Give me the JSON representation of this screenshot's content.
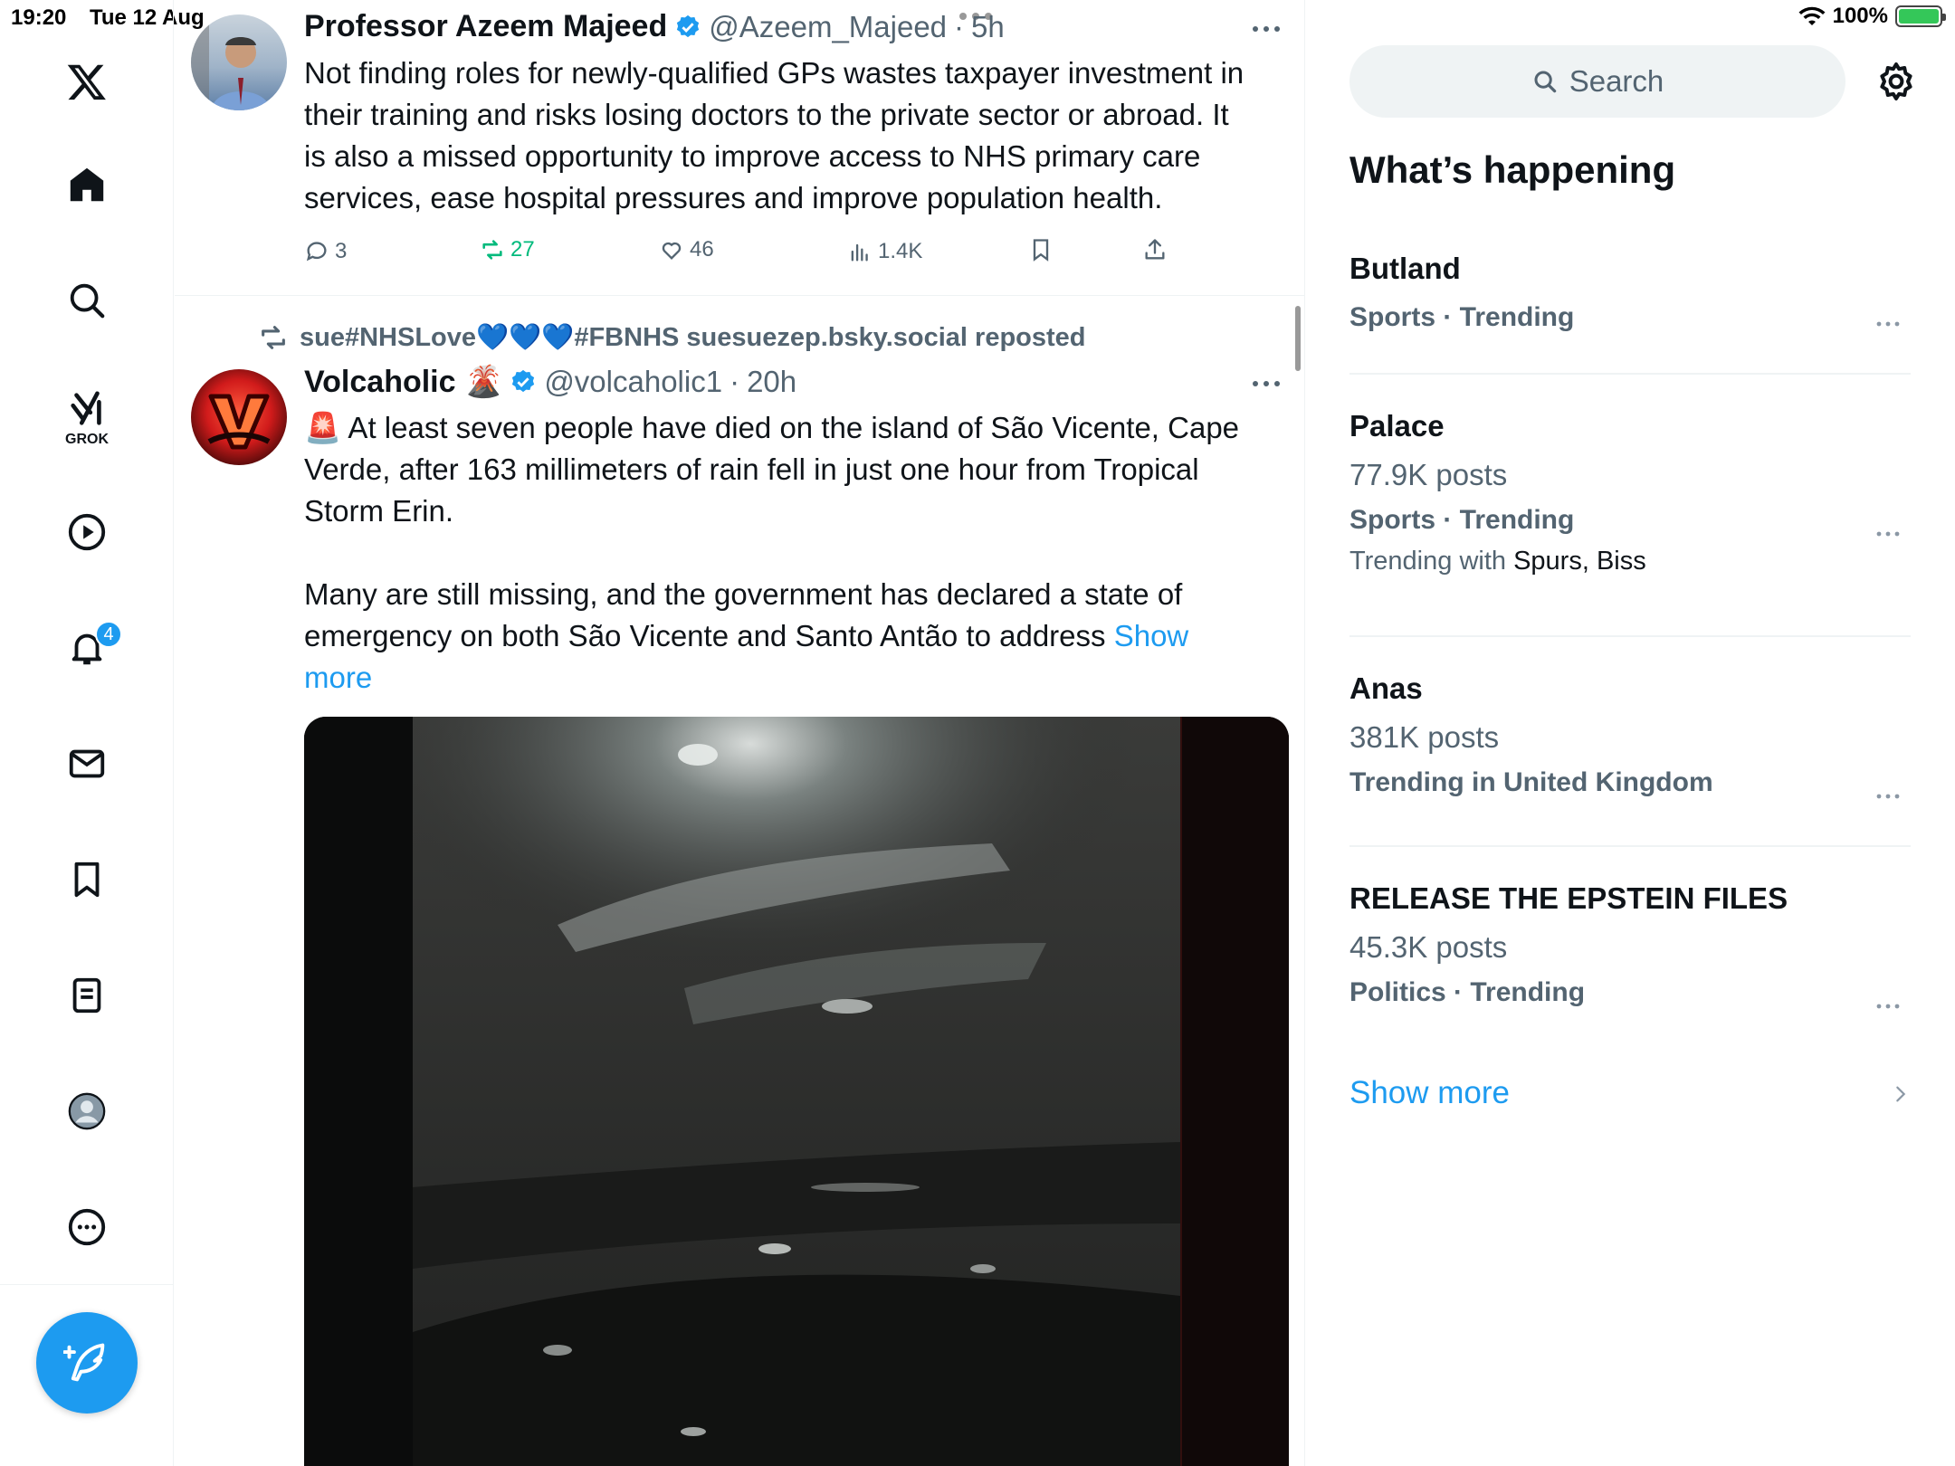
{
  "status_bar": {
    "time": "19:20",
    "date": "Tue 12 Aug",
    "battery": "100%"
  },
  "nav": {
    "items": [
      "x-logo",
      "home",
      "explore",
      "grok",
      "video",
      "notifications",
      "messages",
      "bookmarks",
      "lists",
      "profile",
      "more"
    ],
    "grok_label": "GROK",
    "notification_count": "4",
    "accent": "#1d9bf0"
  },
  "posts": [
    {
      "name": "Professor Azeem Majeed",
      "handle": "@Azeem_Majeed",
      "sep": "·",
      "time": "5h",
      "lines": [
        "Not finding roles for newly-qualified GPs wastes taxpayer investment in",
        "their training and risks losing doctors to the private sector or abroad. It",
        "is also a missed opportunity to improve access to NHS primary care",
        "services, ease hospital pressures and improve population health."
      ],
      "replies": "3",
      "reposts": "27",
      "likes": "46",
      "views": "1.4K"
    },
    {
      "repost_by": "sue#NHSLove💙💙💙#FBNHS suesuezep.bsky.social reposted",
      "name": "Volcaholic 🌋",
      "handle": "@volcaholic1",
      "sep": "·",
      "time": "20h",
      "para1": [
        "🚨 At least seven people have died on the island of São Vicente, Cape",
        "Verde, after 163 millimeters of rain fell in just one hour from Tropical",
        "Storm Erin."
      ],
      "para2_line1": "Many are still missing, and the government has declared a state of",
      "para2_line2": "emergency on both São Vicente and Santo Antão to address ",
      "show_more_1": "Show",
      "show_more_2": "more"
    }
  ],
  "sidebar": {
    "search_placeholder": "Search",
    "title": "What’s happening",
    "trends": [
      {
        "title": "Butland",
        "meta": "Sports · Trending"
      },
      {
        "title": "Palace",
        "count": "77.9K posts",
        "meta": "Sports · Trending",
        "with_label": "Trending with ",
        "with_names": "Spurs, Biss"
      },
      {
        "title": "Anas",
        "count": "381K posts",
        "meta": "Trending in United Kingdom"
      },
      {
        "title": "RELEASE THE EPSTEIN FILES",
        "count": "45.3K posts",
        "meta": "Politics · Trending"
      }
    ],
    "show_more": "Show more"
  }
}
